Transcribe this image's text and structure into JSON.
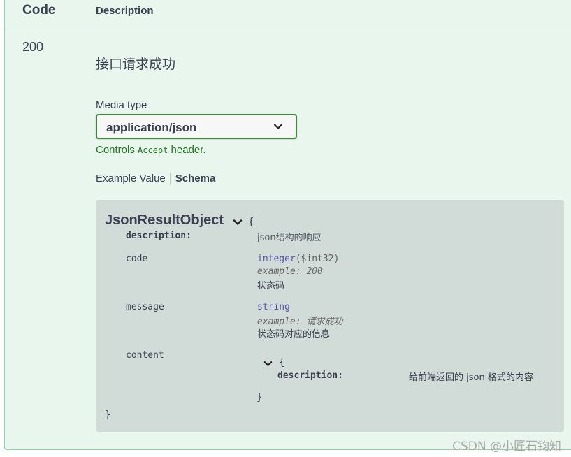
{
  "table": {
    "code_header": "Code",
    "description_header": "Description"
  },
  "response": {
    "code": "200",
    "description": "接口请求成功",
    "media_type_label": "Media type",
    "media_type_value": "application/json",
    "controls_prefix": "Controls ",
    "controls_code": "Accept",
    "controls_suffix": " header."
  },
  "tabs": {
    "example_value": "Example Value",
    "schema": "Schema",
    "active": "Schema"
  },
  "schema": {
    "model_name": "JsonResultObject",
    "open_brace": "{",
    "close_brace": "}",
    "description_key": "description:",
    "description_value": "json结构的响应",
    "properties": [
      {
        "name": "code",
        "type": "integer",
        "format": "($int32)",
        "example": "example: 200",
        "description": "状态码"
      },
      {
        "name": "message",
        "type": "string",
        "example": "example: 请求成功",
        "description": "状态码对应的信息"
      },
      {
        "name": "content",
        "nested_open": "{",
        "nested_description_key": "description:",
        "nested_description_value": "给前端返回的 json 格式的内容",
        "nested_close": "}"
      }
    ]
  },
  "watermark": "CSDN @小匠石钧知",
  "colors": {
    "panel_bg": "#e8f6ee",
    "panel_border": "#8fd1a9",
    "select_border": "#41883b",
    "controls_text": "#1f7a1f",
    "schema_bg": "#d1dcd8",
    "type_color": "#5555aa"
  }
}
